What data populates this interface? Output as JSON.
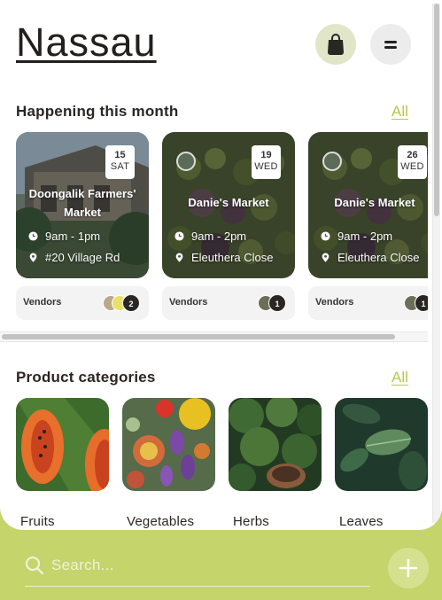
{
  "header": {
    "title": "Nassau",
    "bag_icon": "shopping-bag-icon",
    "menu_icon": "menu-icon"
  },
  "events_section": {
    "title": "Happening this month",
    "all_label": "All",
    "events": [
      {
        "day": "15",
        "weekday": "SAT",
        "name": "Doongalik Farmers' Market",
        "time": "9am - 1pm",
        "location": "#20 Village Rd",
        "vendors_label": "Vendors",
        "vendor_count": "2"
      },
      {
        "day": "19",
        "weekday": "WED",
        "name": "Danie's Market",
        "time": "9am - 2pm",
        "location": "Eleuthera Close",
        "vendors_label": "Vendors",
        "vendor_count": "1"
      },
      {
        "day": "26",
        "weekday": "WED",
        "name": "Danie's Market",
        "time": "9am - 2pm",
        "location": "Eleuthera Close",
        "vendors_label": "Vendors",
        "vendor_count": "1"
      }
    ]
  },
  "categories_section": {
    "title": "Product categories",
    "all_label": "All",
    "categories": [
      {
        "label": "Fruits"
      },
      {
        "label": "Vegetables"
      },
      {
        "label": "Herbs"
      },
      {
        "label": "Leaves"
      }
    ]
  },
  "bottom_bar": {
    "search_placeholder": "Search...",
    "add_icon": "plus-icon"
  },
  "colors": {
    "accent": "#c5d46b",
    "link": "#b7c74a",
    "dark": "#231f1d"
  }
}
